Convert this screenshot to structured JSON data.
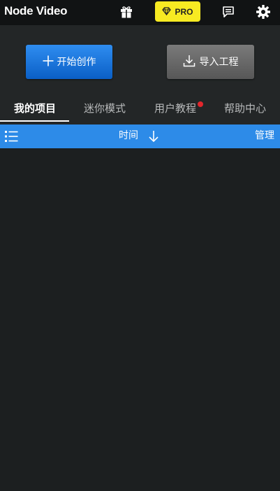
{
  "app": {
    "title": "Node Video"
  },
  "topbar": {
    "icons": [
      "gift-icon",
      "diamond-icon",
      "message-icon",
      "gear-icon"
    ],
    "pro_label": "PRO",
    "pro_color": "#f7ea22"
  },
  "actions": {
    "create_label": "开始创作",
    "import_label": "导入工程",
    "create_color": "#1a78e0",
    "import_color": "#6a6a6a"
  },
  "tabs": [
    {
      "label": "我的项目",
      "active": true,
      "badge": false
    },
    {
      "label": "迷你模式",
      "active": false,
      "badge": false
    },
    {
      "label": "用户教程",
      "active": false,
      "badge": true
    },
    {
      "label": "帮助中心",
      "active": false,
      "badge": false
    }
  ],
  "sortbar": {
    "sort_label": "时间",
    "manage_label": "管理",
    "color": "#2d8be8",
    "icons": [
      "list-view-icon",
      "sort-descending-icon"
    ]
  },
  "projects": []
}
